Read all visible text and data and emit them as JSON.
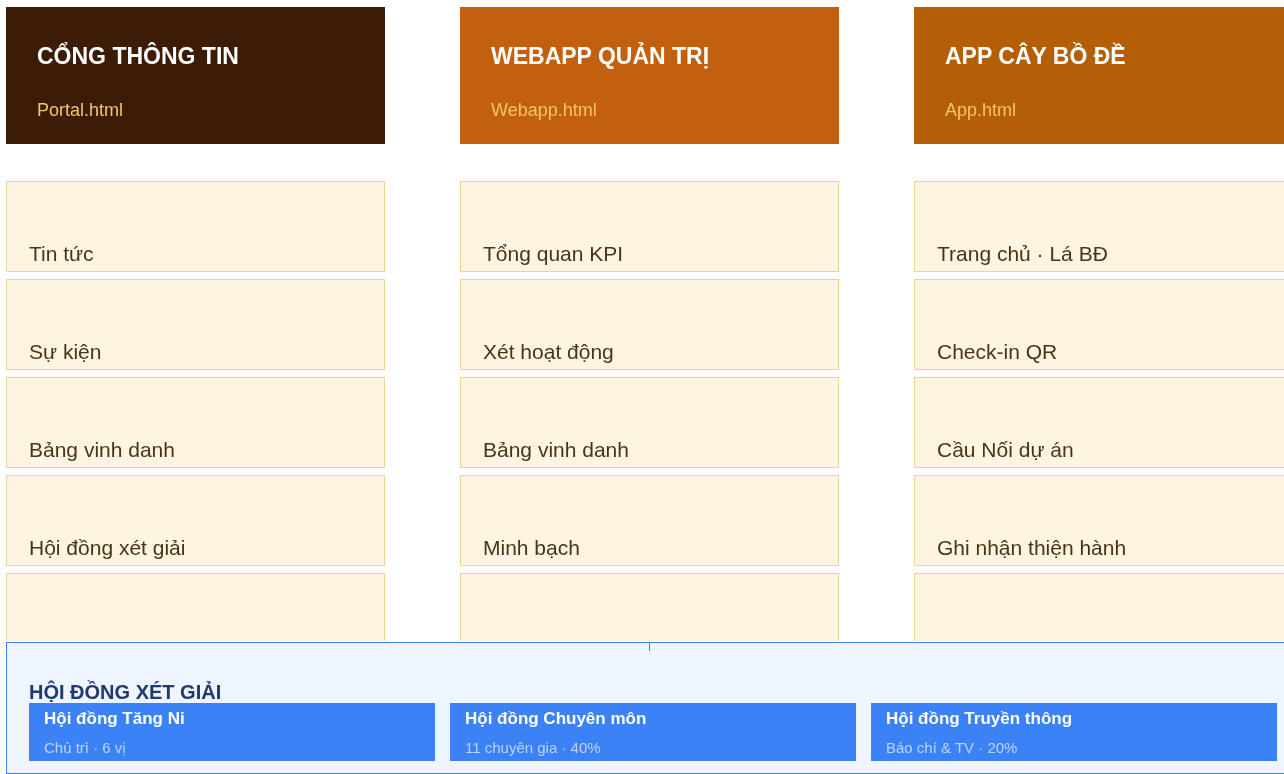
{
  "columns": [
    {
      "title": "CỔNG THÔNG TIN",
      "file": "Portal.html",
      "color": "#3c1c06",
      "items": [
        "Tin tức",
        "Sự kiện",
        "Bảng vinh danh",
        "Hội đồng xét giải"
      ]
    },
    {
      "title": "WEBAPP QUẢN TRỊ",
      "file": "Webapp.html",
      "color": "#c2600f",
      "items": [
        "Tổng quan KPI",
        "Xét hoạt động",
        "Bảng vinh danh",
        "Minh bạch"
      ]
    },
    {
      "title": "APP CÂY BỒ ĐỀ",
      "file": "App.html",
      "color": "#b45f06",
      "items": [
        "Trang chủ · Lá BĐ",
        "Check-in QR",
        "Cầu Nối dự án",
        "Ghi nhận thiện hành"
      ]
    }
  ],
  "panel": {
    "title": "HỘI ĐỒNG XÉT GIẢI",
    "cards": [
      {
        "name": "Hội đồng Tăng Ni",
        "detail": "Chủ trì · 6 vị"
      },
      {
        "name": "Hội đồng Chuyên môn",
        "detail": "11 chuyên gia · 40%"
      },
      {
        "name": "Hội đồng Truyền thông",
        "detail": "Báo chí & TV · 20%"
      }
    ]
  }
}
